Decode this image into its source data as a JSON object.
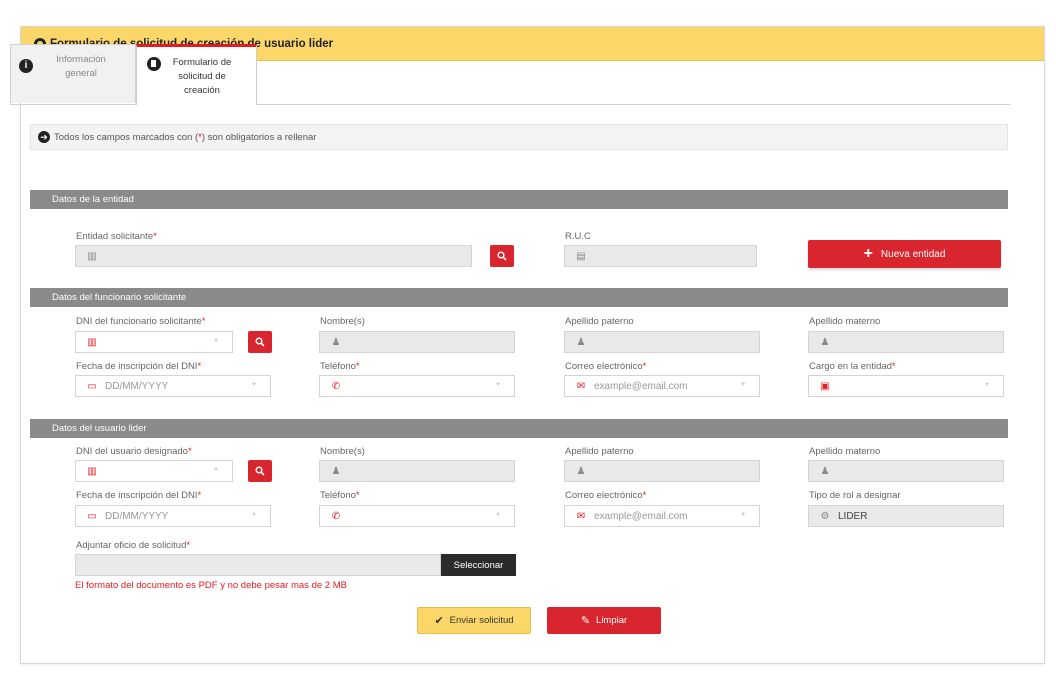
{
  "header": {
    "title": "Formulario de solicitud de creación de usuario lider"
  },
  "tabs": [
    {
      "label": "Información general"
    },
    {
      "label": "Formulario de solicitud de creación"
    }
  ],
  "notice": {
    "prefix": "Todos los campos marcados con (",
    "star": " * ",
    "suffix": ") son obligatorios a rellenar"
  },
  "sections": {
    "entidad": "Datos de la entidad",
    "funcionario": "Datos del funcionario solicitante",
    "usuario": "Datos del usuario lider"
  },
  "entidad": {
    "entidad_label": "Entidad solicitante",
    "ruc_label": "R.U.C",
    "nueva_label": "Nueva entidad"
  },
  "funcionario": {
    "dni_label": "DNI del funcionario solicitante",
    "nombre_label": "Nombre(s)",
    "ap_paterno_label": "Apellido paterno",
    "ap_materno_label": "Apellido materno",
    "fecha_label": "Fecha de inscripción del DNI",
    "fecha_placeholder": "DD/MM/YYYY",
    "telefono_label": "Teléfono",
    "correo_label": "Correo electrónico",
    "correo_placeholder": "example@email.com",
    "cargo_label": "Cargo en la entidad"
  },
  "usuario": {
    "dni_label": "DNI del usuario designado",
    "nombre_label": "Nombre(s)",
    "ap_paterno_label": "Apellido paterno",
    "ap_materno_label": "Apellido materno",
    "fecha_label": "Fecha de inscripción del DNI",
    "fecha_placeholder": "DD/MM/YYYY",
    "telefono_label": "Teléfono",
    "correo_label": "Correo electrónico",
    "correo_placeholder": "example@email.com",
    "rol_label": "Tipo de rol a designar",
    "rol_value": "LIDER"
  },
  "adjunto": {
    "label": "Adjuntar oficio de solicitud",
    "button": "Seleccionar",
    "hint": "El formato del documento es PDF y no debe pesar mas de 2 MB"
  },
  "actions": {
    "send": "Enviar solicitud",
    "clear": "Limpiar"
  },
  "required_mark": "*",
  "colors": {
    "accent_yellow": "#fbd76a",
    "accent_red": "#d9252d",
    "section_gray": "#8a8a8a"
  }
}
